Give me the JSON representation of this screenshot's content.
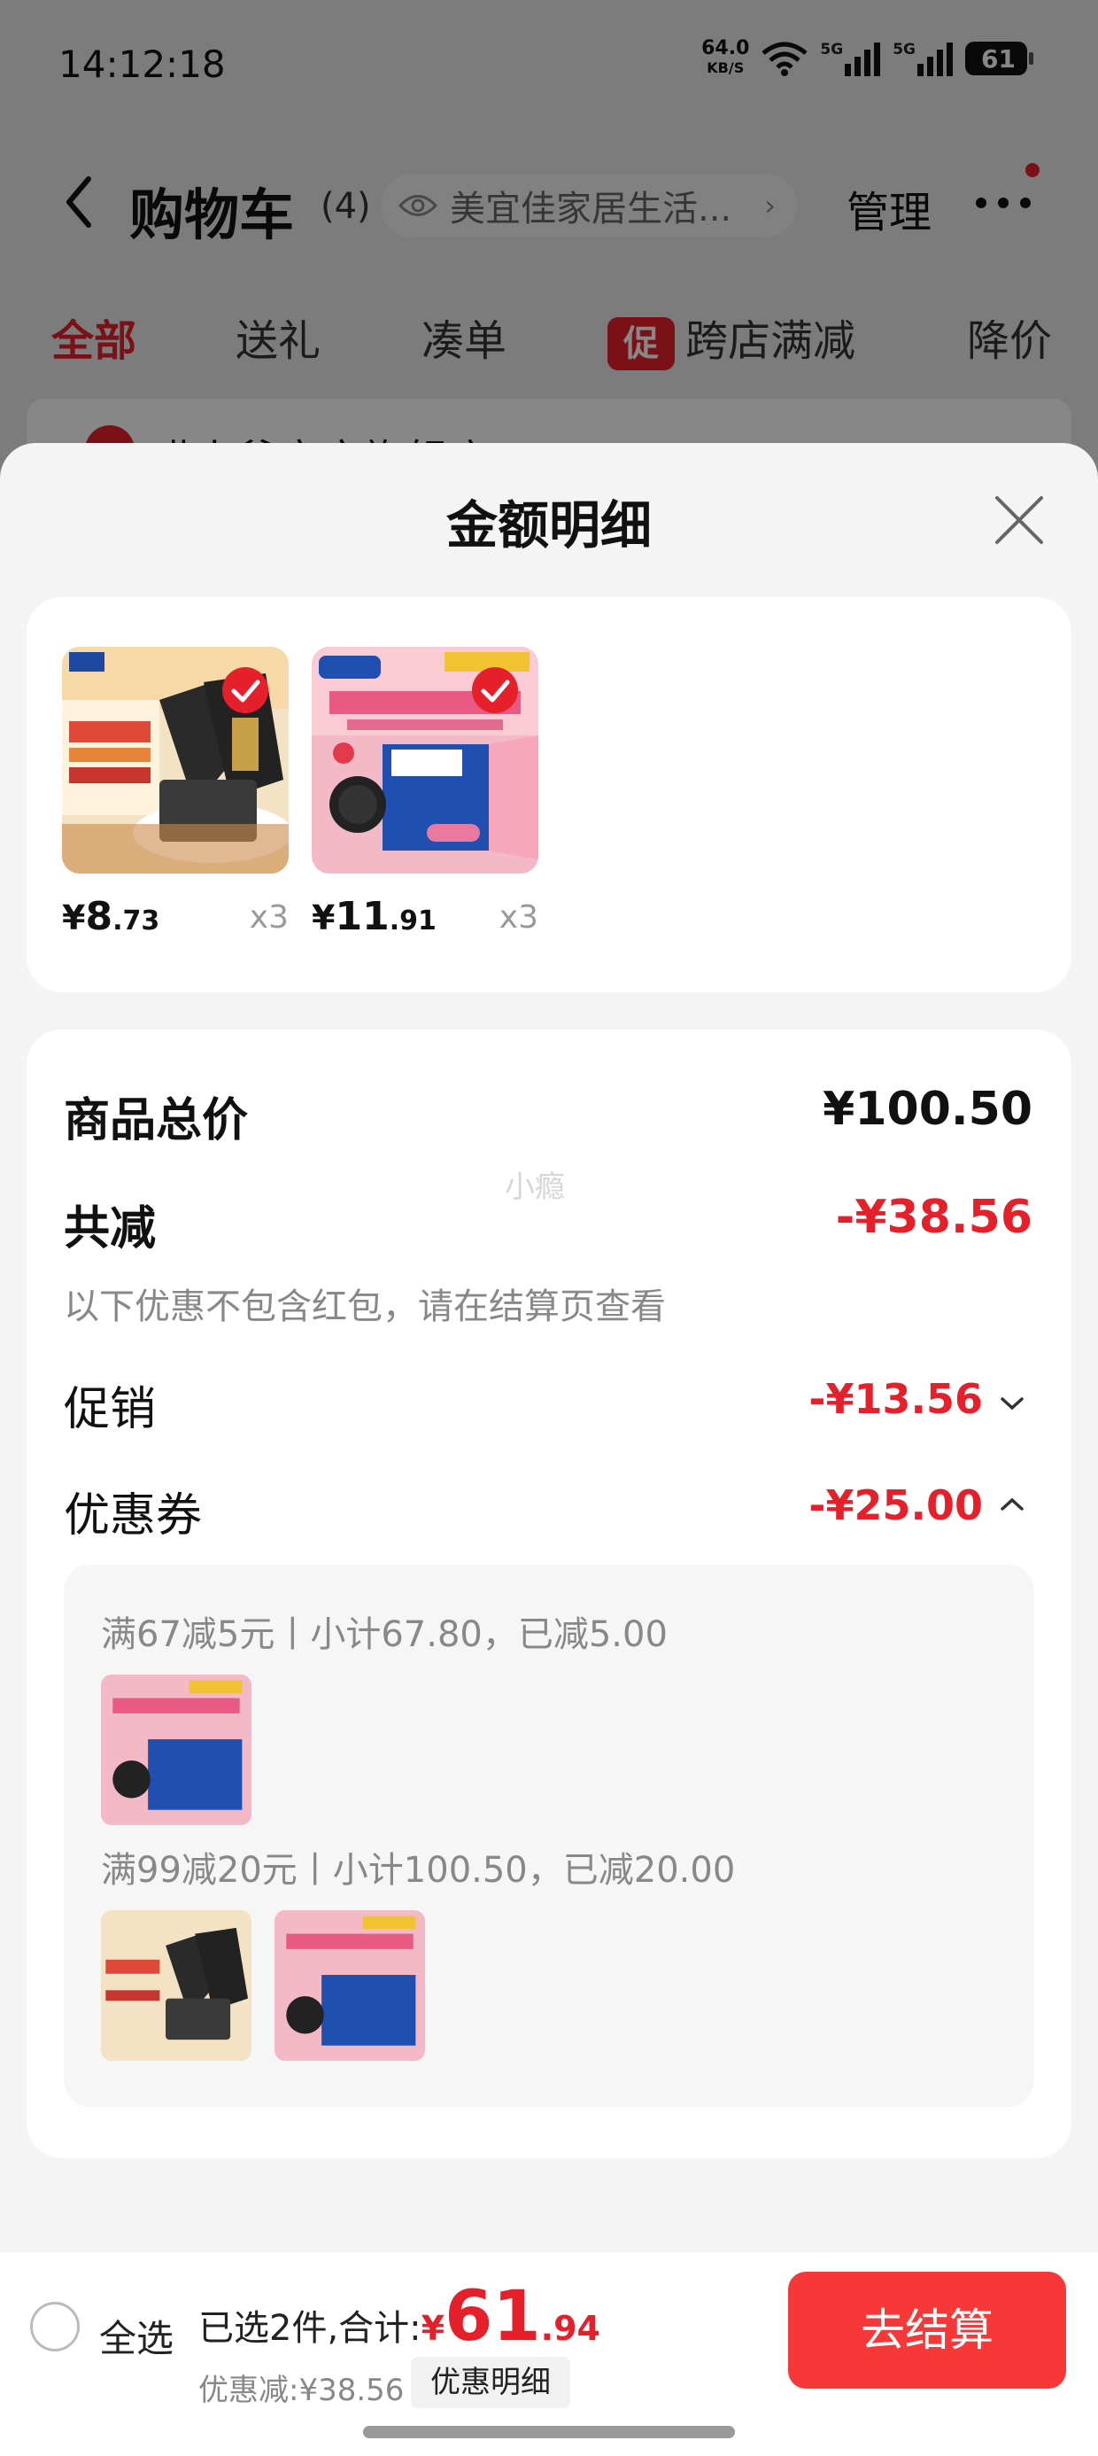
{
  "status_bar": {
    "time": "14:12:18",
    "net_speed": "64.0",
    "net_unit": "KB/S",
    "sim1": "5G",
    "sim2": "5G",
    "battery": "61"
  },
  "header": {
    "title": "购物车",
    "count": "(4)",
    "store_name": "美宜佳家居生活...",
    "manage_label": "管理"
  },
  "tabs": [
    {
      "label": "全部",
      "active": true
    },
    {
      "label": "送礼"
    },
    {
      "label": "凑单"
    },
    {
      "label": "跨店满减",
      "badge": "促"
    },
    {
      "label": "降价"
    }
  ],
  "store_row": {
    "name": "喵小爷官方旗舰店 "
  },
  "sheet": {
    "title": "金额明细",
    "products": [
      {
        "price_symbol": "¥",
        "price_int": "8",
        "price_dec": ".73",
        "qty": "x3",
        "name": "biscuit-pack"
      },
      {
        "price_symbol": "¥",
        "price_int": "11",
        "price_dec": ".91",
        "qty": "x3",
        "name": "strawberry-cookie-box"
      }
    ],
    "watermark": "小瘾",
    "summary": {
      "total_label": "商品总价",
      "total_value": "¥100.50",
      "discount_label": "共减",
      "discount_value": "-¥38.56",
      "note": "以下优惠不包含红包，请在结算页查看",
      "promo_label": "促销",
      "promo_value": "-¥13.56",
      "coupon_label": "优惠券",
      "coupon_value": "-¥25.00"
    },
    "coupons": [
      {
        "rule": "满67减5元丨小计67.80，已减5.00"
      },
      {
        "rule": "满99减20元丨小计100.50，已减20.00"
      }
    ]
  },
  "bottom_bar": {
    "select_all": "全选",
    "selected_prefix": "已选2件,合计:",
    "total_symbol": "¥",
    "total_int": "61",
    "total_dec": ".94",
    "discount_text": "优惠减:¥38.56",
    "detail_label": "优惠明细",
    "checkout_label": "去结算"
  },
  "colors": {
    "accent_red": "#e6202a",
    "checkout_red": "#f63838"
  }
}
